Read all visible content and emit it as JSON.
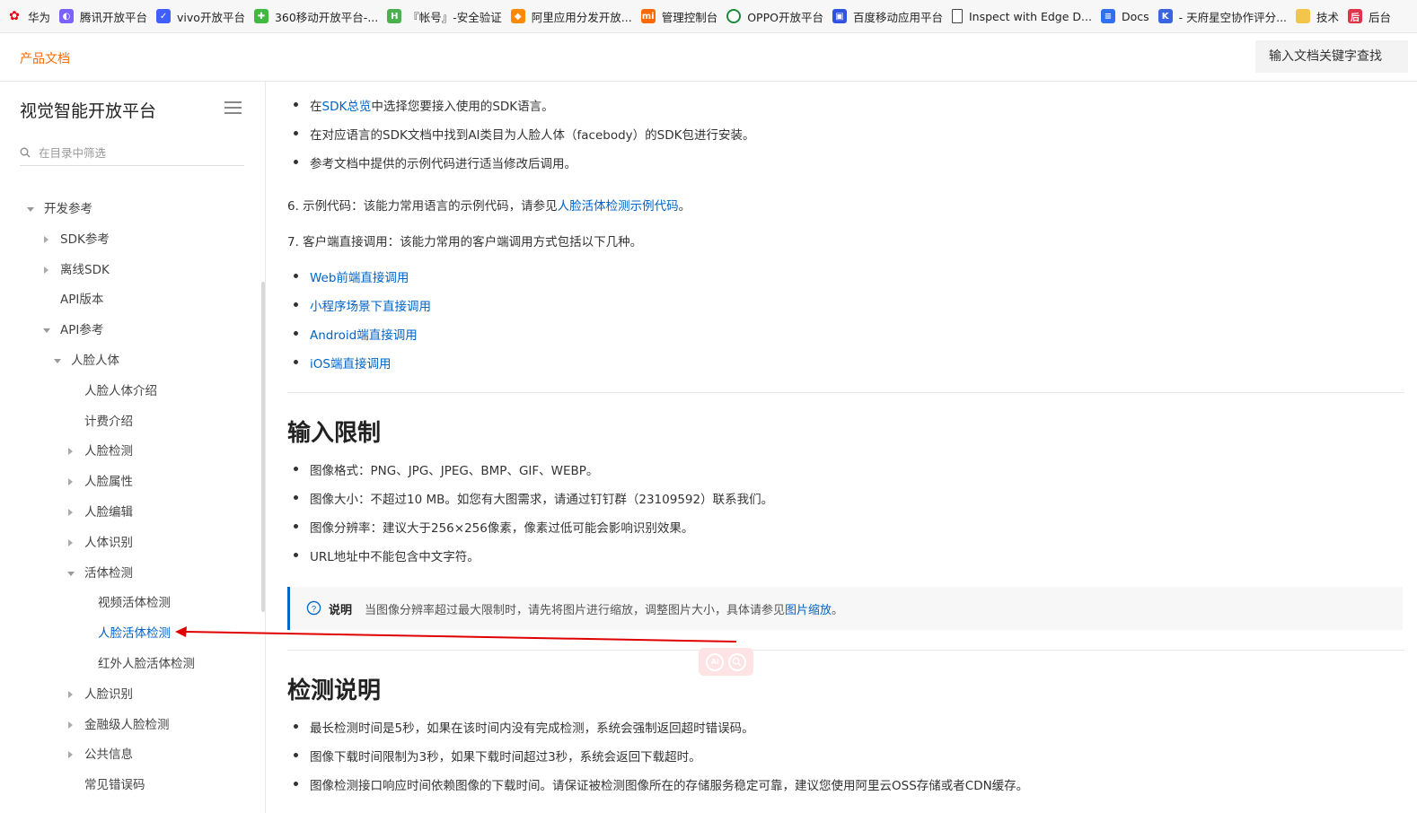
{
  "bookmarks": [
    {
      "label": "华为",
      "icon": "huawei-icon",
      "color": "#e60012"
    },
    {
      "label": "腾讯开放平台",
      "icon": "tencent-icon",
      "color": "#7b61ff"
    },
    {
      "label": "vivo开放平台",
      "icon": "vivo-icon",
      "color": "#415fff"
    },
    {
      "label": "360移动开放平台-...",
      "icon": "360-icon",
      "color": "#3fb93f"
    },
    {
      "label": "『帐号』-安全验证",
      "icon": "h-icon",
      "color": "#4cb050"
    },
    {
      "label": "阿里应用分发开放...",
      "icon": "ali-icon",
      "color": "#ff8a00"
    },
    {
      "label": "管理控制台",
      "icon": "mi-icon",
      "color": "#ff6900"
    },
    {
      "label": "OPPO开放平台",
      "icon": "oppo-icon",
      "color": "#1a8a3a"
    },
    {
      "label": "百度移动应用平台",
      "icon": "baidu-icon",
      "color": "#3052e0"
    },
    {
      "label": "Inspect with Edge D...",
      "icon": "page-icon",
      "color": "#ffffff"
    },
    {
      "label": "Docs",
      "icon": "docs-icon",
      "color": "#2f6ff0"
    },
    {
      "label": "- 天府星空协作评分...",
      "icon": "k-icon",
      "color": "#3b64e0"
    },
    {
      "label": "技术",
      "icon": "folder-icon",
      "color": "#f3c54a"
    },
    {
      "label": "后台",
      "icon": "back-icon",
      "color": "#e0344b"
    }
  ],
  "header": {
    "brand": "产品文档",
    "search_placeholder": "输入文档关键字查找"
  },
  "sidebar": {
    "title": "视觉智能开放平台",
    "filter_placeholder": "在目录中筛选",
    "items": [
      {
        "label": "开发参考",
        "caret": "down"
      },
      {
        "label": "SDK参考",
        "caret": "right"
      },
      {
        "label": "离线SDK",
        "caret": "right"
      },
      {
        "label": "API版本",
        "caret": ""
      },
      {
        "label": "API参考",
        "caret": "down"
      },
      {
        "label": "人脸人体",
        "caret": "down"
      },
      {
        "label": "人脸人体介绍",
        "caret": ""
      },
      {
        "label": "计费介绍",
        "caret": ""
      },
      {
        "label": "人脸检测",
        "caret": "right"
      },
      {
        "label": "人脸属性",
        "caret": "right"
      },
      {
        "label": "人脸编辑",
        "caret": "right"
      },
      {
        "label": "人体识别",
        "caret": "right"
      },
      {
        "label": "活体检测",
        "caret": "down"
      },
      {
        "label": "视频活体检测",
        "caret": ""
      },
      {
        "label": "人脸活体检测",
        "caret": "",
        "active": true
      },
      {
        "label": "红外人脸活体检测",
        "caret": ""
      },
      {
        "label": "人脸识别",
        "caret": "right"
      },
      {
        "label": "金融级人脸检测",
        "caret": "right"
      },
      {
        "label": "公共信息",
        "caret": "right"
      },
      {
        "label": "常见错误码",
        "caret": ""
      }
    ]
  },
  "content": {
    "steps_bullets": [
      {
        "pre": "在",
        "link": "SDK总览",
        "post": "中选择您要接入使用的SDK语言。"
      },
      {
        "pre": "在对应语言的SDK文档中找到AI类目为人脸人体（facebody）的SDK包进行安装。",
        "link": "",
        "post": ""
      },
      {
        "pre": "参考文档中提供的示例代码进行适当修改后调用。",
        "link": "",
        "post": ""
      }
    ],
    "step6": {
      "pre": "6. 示例代码：该能力常用语言的示例代码，请参见",
      "link": "人脸活体检测示例代码",
      "post": "。"
    },
    "step7": "7. 客户端直接调用：该能力常用的客户端调用方式包括以下几种。",
    "client_links": [
      "Web前端直接调用",
      "小程序场景下直接调用",
      "Android端直接调用",
      "iOS端直接调用"
    ],
    "input_limit": {
      "title": "输入限制",
      "items": [
        "图像格式：PNG、JPG、JPEG、BMP、GIF、WEBP。",
        "图像大小：不超过10 MB。如您有大图需求，请通过钉钉群（23109592）联系我们。",
        "图像分辨率：建议大于256×256像素，像素过低可能会影响识别效果。",
        "URL地址中不能包含中文字符。"
      ]
    },
    "note": {
      "title": "说明",
      "text": "当图像分辨率超过最大限制时，请先将图片进行缩放，调整图片大小，具体请参见",
      "link": "图片缩放",
      "post": "。"
    },
    "detect": {
      "title": "检测说明",
      "items": [
        "最长检测时间是5秒，如果在该时间内没有完成检测，系统会强制返回超时错误码。",
        "图像下载时间限制为3秒，如果下载时间超过3秒，系统会返回下载超时。",
        "图像检测接口响应时间依赖图像的下载时间。请保证被检测图像所在的存储服务稳定可靠，建议您使用阿里云OSS存储或者CDN缓存。"
      ]
    },
    "ai_badge": "AI"
  },
  "annotation": {
    "color": "#e00000"
  }
}
